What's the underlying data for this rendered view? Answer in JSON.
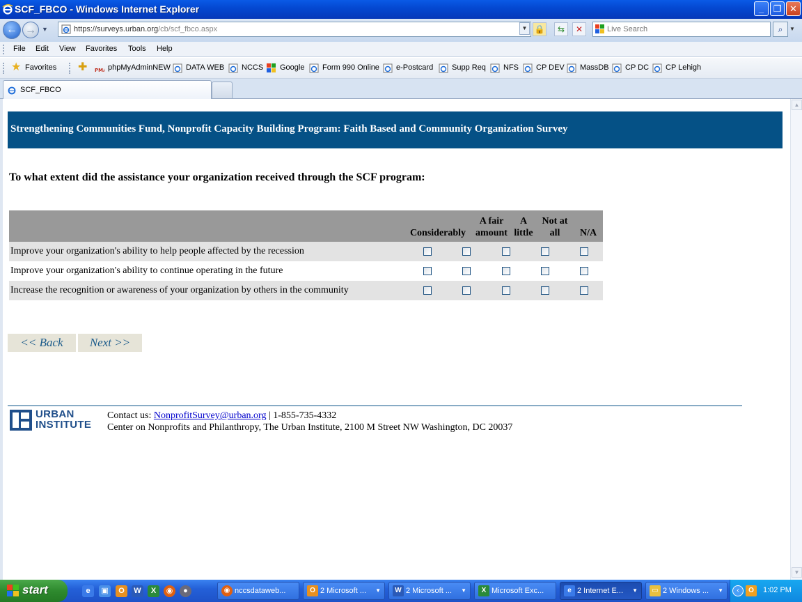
{
  "window": {
    "title": "SCF_FBCO - Windows Internet Explorer"
  },
  "address": {
    "protocol": "https://",
    "host_main": "surveys.urban.org",
    "host_pre": "",
    "path": "/cb/scf_fbco.aspx"
  },
  "search": {
    "placeholder": "Live Search"
  },
  "menu": [
    "File",
    "Edit",
    "View",
    "Favorites",
    "Tools",
    "Help"
  ],
  "favorites": {
    "label": "Favorites",
    "items": [
      "phpMyAdminNEW",
      "DATA WEB",
      "NCCS",
      "Google",
      "Form 990 Online",
      "e-Postcard",
      "Supp Req",
      "NFS",
      "CP DEV",
      "MassDB",
      "CP DC",
      "CP Lehigh"
    ]
  },
  "tab": {
    "label": "SCF_FBCO"
  },
  "survey": {
    "header": "Strengthening Communities Fund, Nonprofit Capacity Building Program: Faith Based and Community Organization Survey",
    "question": "To what extent did the assistance your organization received through the SCF program:",
    "columns": [
      {
        "line1": "",
        "line2": "Considerably"
      },
      {
        "line1": "A fair",
        "line2": "amount"
      },
      {
        "line1": "A",
        "line2": "little"
      },
      {
        "line1": "Not at",
        "line2": "all"
      },
      {
        "line1": "",
        "line2": "N/A"
      }
    ],
    "rows": [
      "Improve your organization's ability to help people affected by the recession",
      "Improve your organization's ability to continue operating in the future",
      "Increase the recognition or awareness of your organization by others in the community"
    ],
    "back_label": "<< Back",
    "next_label": "Next >>"
  },
  "footer": {
    "logo_line1": "URBAN",
    "logo_line2": "INSTITUTE",
    "contact_prefix": "Contact us: ",
    "email": "NonprofitSurvey@urban.org",
    "phone": " | 1-855-735-4332",
    "address": "Center on Nonprofits and Philanthropy, The Urban Institute, 2100 M Street NW Washington, DC 20037"
  },
  "taskbar": {
    "start_label": "start",
    "tasks": [
      "nccsdataweb...",
      "2 Microsoft ...",
      "2 Microsoft ...",
      "Microsoft Exc...",
      "2 Internet E...",
      "2 Windows ..."
    ],
    "clock": "1:02 PM"
  },
  "colors": {
    "header_bg": "#055186",
    "grid_head": "#999999",
    "row_shade": "#e3e3e3",
    "link": "#0000cc"
  }
}
